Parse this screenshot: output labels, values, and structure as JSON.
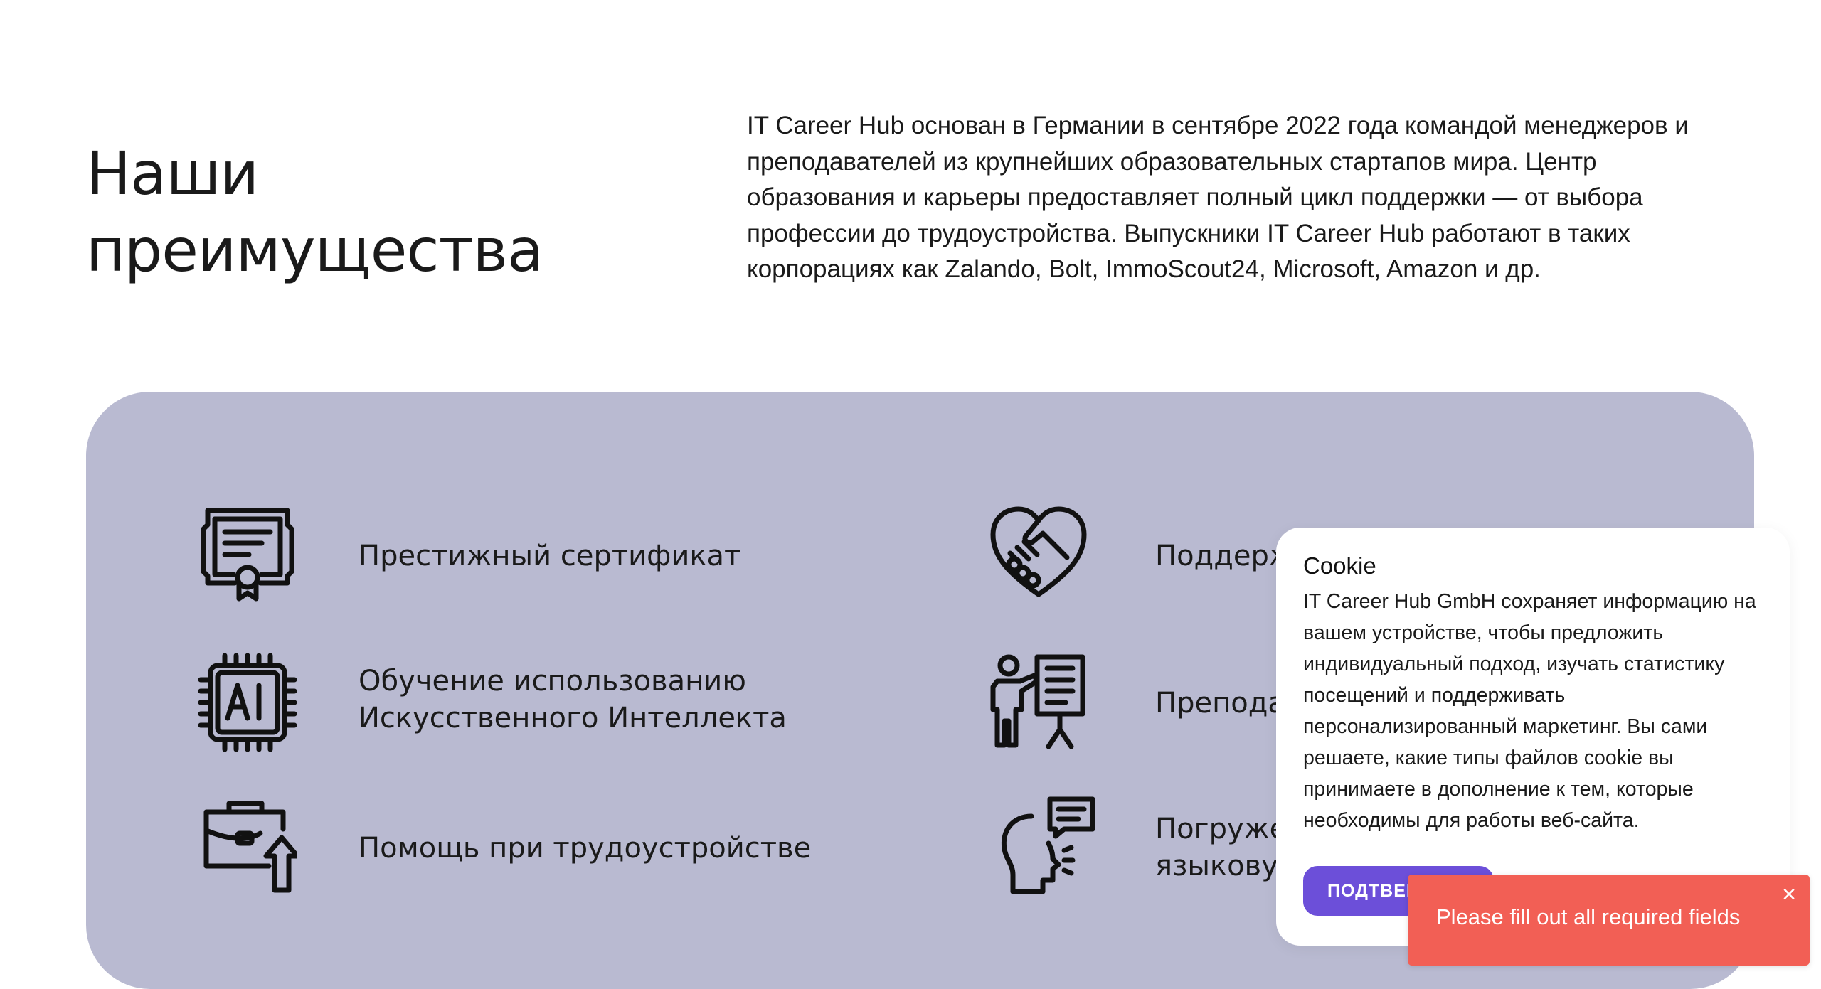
{
  "section": {
    "heading_line1": "Наши",
    "heading_line2": "преимущества",
    "intro": "IT Career Hub основан в Германии в сентябре 2022 года командой менеджеров и преподавателей из крупнейших образовательных стартапов мира. Центр образования и карьеры предоставляет полный цикл поддержки — от выбора профессии до трудоустройства. Выпускники IT Career Hub работают в таких корпорациях как Zalando, Bolt, ImmoScout24, Microsoft, Amazon и др."
  },
  "features": {
    "left": [
      {
        "icon": "certificate-icon",
        "line1": "Престижный сертификат",
        "line2": ""
      },
      {
        "icon": "ai-chip-icon",
        "line1": "Обучение использованию",
        "line2": "Искусственного Интеллекта"
      },
      {
        "icon": "briefcase-up-icon",
        "line1": "Помощь при трудоустройстве",
        "line2": ""
      }
    ],
    "right": [
      {
        "icon": "heart-handshake-icon",
        "line1": "Поддерж",
        "line2": ""
      },
      {
        "icon": "teacher-board-icon",
        "line1": "Препода",
        "line2": ""
      },
      {
        "icon": "speaking-head-icon",
        "line1": "Погружен",
        "line2": "языковук"
      }
    ]
  },
  "cookie": {
    "title": "Cookie",
    "text": "IT Career Hub GmbH сохраняет информацию на вашем устройстве, чтобы предложить индивидуальный подход, изучать статистику посещений и поддерживать персонализированный маркетинг. Вы сами решаете, какие типы файлов cookie вы принимаете в дополнение к тем, которые необходимы для работы веб-сайта.",
    "confirm_label": "ПОДТВЕРДИТЬ"
  },
  "toast": {
    "message": "Please fill out all required fields",
    "close_icon": "close-icon"
  },
  "colors": {
    "panel": "#b9bad1",
    "accent": "#6c4fd9",
    "toast": "#f25f55"
  }
}
